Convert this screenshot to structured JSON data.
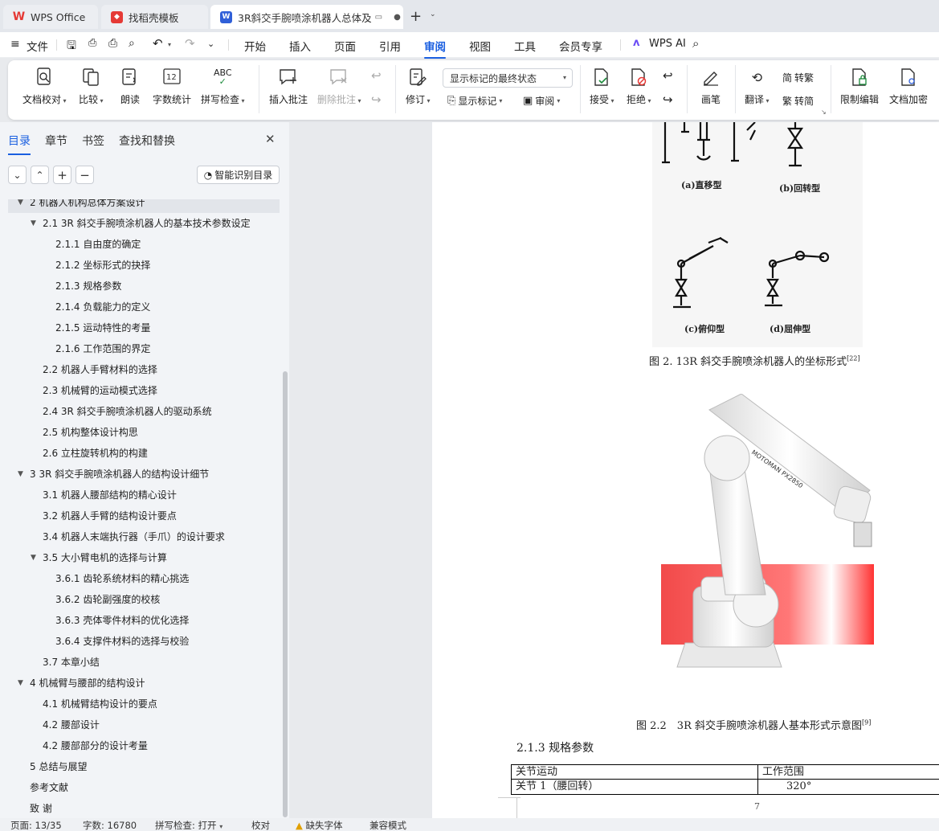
{
  "tabs": [
    {
      "label": "WPS Office",
      "active": false
    },
    {
      "label": "找稻壳模板",
      "active": false
    },
    {
      "label": "3R斜交手腕喷涂机器人总体及",
      "active": true
    }
  ],
  "new_tab": "+",
  "menu": {
    "file": "文件",
    "items": [
      "开始",
      "插入",
      "页面",
      "引用",
      "审阅",
      "视图",
      "工具",
      "会员专享"
    ],
    "active": "审阅",
    "wps_ai": "WPS AI"
  },
  "ribbon": {
    "doc_proof": "文档校对",
    "compare": "比较",
    "read_aloud": "朗读",
    "word_count": "字数统计",
    "spell_check": "拼写检查",
    "insert_comment": "插入批注",
    "delete_comment": "删除批注",
    "revise": "修订",
    "track_state": "显示标记的最终状态",
    "show_markup": "显示标记",
    "review": "审阅",
    "accept": "接受",
    "reject": "拒绝",
    "pen": "画笔",
    "translate": "翻译",
    "to_traditional": "转繁",
    "to_simplified": "转简",
    "restrict_edit": "限制编辑",
    "encrypt": "文档加密"
  },
  "nav_panel": {
    "tabs": [
      "目录",
      "章节",
      "书签",
      "查找和替换"
    ],
    "active_tab": "目录",
    "smart_toc": "智能识别目录"
  },
  "toc": [
    {
      "text": "2 机器人机构总体方案设计",
      "level": 1,
      "arrow": true
    },
    {
      "text": "2.1 3R 斜交手腕喷涂机器人的基本技术参数设定",
      "level": 2,
      "arrow": true
    },
    {
      "text": "2.1.1  自由度的确定",
      "level": 3
    },
    {
      "text": "2.1.2  坐标形式的抉择",
      "level": 3
    },
    {
      "text": "2.1.3 规格参数",
      "level": 3
    },
    {
      "text": "2.1.4  负载能力的定义",
      "level": 3
    },
    {
      "text": "2.1.5  运动特性的考量",
      "level": 3
    },
    {
      "text": "2.1.6  工作范围的界定",
      "level": 3
    },
    {
      "text": "2.2  机器人手臂材料的选择",
      "level": 2
    },
    {
      "text": "2.3  机械臂的运动模式选择",
      "level": 2
    },
    {
      "text": "2.4 3R 斜交手腕喷涂机器人的驱动系统",
      "level": 2
    },
    {
      "text": "2.5  机构整体设计构思",
      "level": 2
    },
    {
      "text": "2.6  立柱旋转机构的构建",
      "level": 2
    },
    {
      "text": "3 3R 斜交手腕喷涂机器人的结构设计细节",
      "level": 1,
      "arrow": true
    },
    {
      "text": "3.1  机器人腰部结构的精心设计",
      "level": 2
    },
    {
      "text": "3.2  机器人手臂的结构设计要点",
      "level": 2
    },
    {
      "text": "3.4  机器人末端执行器（手爪）的设计要求",
      "level": 2
    },
    {
      "text": "3.5  大小臂电机的选择与计算",
      "level": 2,
      "arrow": true
    },
    {
      "text": "3.6.1  齿轮系统材料的精心挑选",
      "level": 3
    },
    {
      "text": "3.6.2  齿轮副强度的校核",
      "level": 3
    },
    {
      "text": "3.6.3  壳体零件材料的优化选择",
      "level": 3
    },
    {
      "text": "3.6.4  支撑件材料的选择与校验",
      "level": 3
    },
    {
      "text": "3.7 本章小结",
      "level": 2
    },
    {
      "text": "4  机械臂与腰部的结构设计",
      "level": 1,
      "arrow": true
    },
    {
      "text": "4.1  机械臂结构设计的要点",
      "level": 2
    },
    {
      "text": "4.2  腰部设计",
      "level": 2
    },
    {
      "text": "4.2  腰部部分的设计考量",
      "level": 2
    },
    {
      "text": "5  总结与展望",
      "level": 1
    },
    {
      "text": "参考文献",
      "level": 1
    },
    {
      "text": "致  谢",
      "level": 1
    }
  ],
  "document": {
    "fig_labels": [
      "(a)直移型",
      "(b)回转型",
      "(c)俯仰型",
      "(d)屈伸型"
    ],
    "fig1_caption": "图 2. 13R 斜交手腕喷涂机器人的坐标形式",
    "fig1_ref": "[22]",
    "robot_brand": "MOTOMAN PX2850",
    "fig2_caption": "图 2.2　3R 斜交手腕喷涂机器人基本形式示意图",
    "fig2_ref": "[9]",
    "section_heading": "2.1.3 规格参数",
    "table": {
      "headers": [
        "关节运动",
        "工作范围"
      ],
      "rows": [
        [
          "关节 1（腰回转）",
          "320°"
        ]
      ]
    },
    "page_number": "7"
  },
  "status_bar": {
    "page": "页面: 13/35",
    "words": "字数: 16780",
    "spell": "拼写检查: 打开",
    "proof": "校对",
    "missing_font": "缺失字体",
    "compat": "兼容模式"
  },
  "colors": {
    "accent": "#1a5fe0",
    "wps_red": "#e53935",
    "doc_blue": "#2f5fd8"
  }
}
